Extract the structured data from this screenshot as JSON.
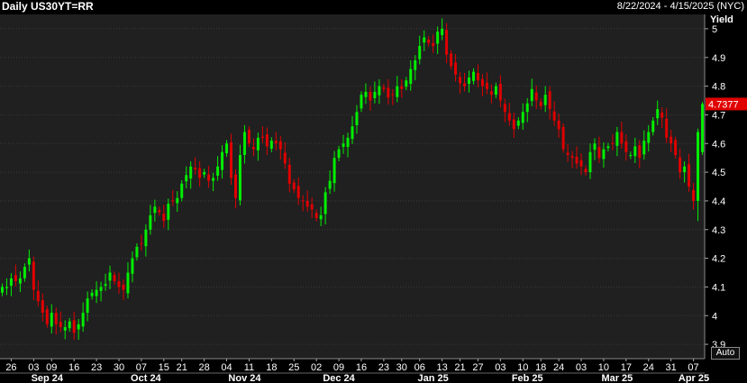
{
  "header": {
    "title": "Daily US30YT=RR",
    "date_range": "8/22/2024 - 4/15/2025 (NYC)"
  },
  "y_axis": {
    "label": "Yield",
    "auto_label": "Auto"
  },
  "colors": {
    "background": "#000000",
    "plot": "#202020",
    "grid": "#3a3a3a",
    "up": "#00ee00",
    "down": "#e00000",
    "badge": "#e00000",
    "text": "#ffffff"
  },
  "chart_data": {
    "type": "candlestick",
    "title": "Daily US30YT=RR",
    "ylabel": "Yield",
    "ylim": [
      3.85,
      5.05
    ],
    "yticks": [
      3.9,
      4,
      4.1,
      4.2,
      4.3,
      4.4,
      4.5,
      4.6,
      4.7,
      4.8,
      4.9,
      5
    ],
    "ytick_labels": [
      "3.9",
      "4",
      "4.1",
      "4.2",
      "4.3",
      "4.4",
      "4.5",
      "4.6",
      "4.7",
      "4.8",
      "4.9",
      "5"
    ],
    "last_value_label": "4.7377",
    "last_value": 4.7377,
    "grid": true,
    "day_ticks": [
      {
        "label": "26",
        "i": 2
      },
      {
        "label": "03",
        "i": 7
      },
      {
        "label": "09",
        "i": 11
      },
      {
        "label": "16",
        "i": 16
      },
      {
        "label": "23",
        "i": 21
      },
      {
        "label": "30",
        "i": 26
      },
      {
        "label": "07",
        "i": 31
      },
      {
        "label": "15",
        "i": 36
      },
      {
        "label": "21",
        "i": 40
      },
      {
        "label": "28",
        "i": 45
      },
      {
        "label": "04",
        "i": 50
      },
      {
        "label": "11",
        "i": 55
      },
      {
        "label": "18",
        "i": 60
      },
      {
        "label": "25",
        "i": 65
      },
      {
        "label": "02",
        "i": 70
      },
      {
        "label": "09",
        "i": 75
      },
      {
        "label": "16",
        "i": 80
      },
      {
        "label": "23",
        "i": 85
      },
      {
        "label": "30",
        "i": 89
      },
      {
        "label": "06",
        "i": 93
      },
      {
        "label": "13",
        "i": 98
      },
      {
        "label": "21",
        "i": 102
      },
      {
        "label": "27",
        "i": 106
      },
      {
        "label": "03",
        "i": 111
      },
      {
        "label": "10",
        "i": 116
      },
      {
        "label": "18",
        "i": 120
      },
      {
        "label": "24",
        "i": 124
      },
      {
        "label": "03",
        "i": 129
      },
      {
        "label": "10",
        "i": 134
      },
      {
        "label": "17",
        "i": 139
      },
      {
        "label": "24",
        "i": 144
      },
      {
        "label": "31",
        "i": 149
      },
      {
        "label": "07",
        "i": 154
      },
      {
        "label": "14",
        "i": 159
      }
    ],
    "month_ticks": [
      {
        "label": "Sep 24",
        "i": 10
      },
      {
        "label": "Oct 24",
        "i": 32
      },
      {
        "label": "Nov 24",
        "i": 54
      },
      {
        "label": "Dec 24",
        "i": 75
      },
      {
        "label": "Jan 25",
        "i": 96
      },
      {
        "label": "Feb 25",
        "i": 117
      },
      {
        "label": "Mar 25",
        "i": 137
      },
      {
        "label": "Apr 25",
        "i": 157
      }
    ],
    "closes": [
      4.1,
      4.1,
      4.13,
      4.12,
      4.13,
      4.17,
      4.2,
      4.09,
      4.05,
      4.01,
      3.97,
      4.01,
      3.97,
      3.96,
      3.96,
      3.98,
      3.94,
      3.97,
      4.01,
      4.06,
      4.08,
      4.09,
      4.1,
      4.11,
      4.15,
      4.12,
      4.1,
      4.09,
      4.15,
      4.2,
      4.24,
      4.25,
      4.3,
      4.35,
      4.38,
      4.36,
      4.33,
      4.39,
      4.4,
      4.41,
      4.46,
      4.49,
      4.52,
      4.51,
      4.48,
      4.5,
      4.47,
      4.48,
      4.52,
      4.57,
      4.6,
      4.48,
      4.41,
      4.56,
      4.64,
      4.6,
      4.58,
      4.62,
      4.62,
      4.59,
      4.61,
      4.6,
      4.58,
      4.53,
      4.46,
      4.44,
      4.41,
      4.4,
      4.38,
      4.37,
      4.34,
      4.35,
      4.43,
      4.47,
      4.55,
      4.58,
      4.6,
      4.62,
      4.66,
      4.71,
      4.77,
      4.78,
      4.75,
      4.78,
      4.8,
      4.79,
      4.76,
      4.77,
      4.8,
      4.79,
      4.82,
      4.86,
      4.89,
      4.94,
      4.97,
      4.95,
      4.94,
      4.99,
      5,
      4.91,
      4.87,
      4.84,
      4.81,
      4.8,
      4.83,
      4.85,
      4.82,
      4.8,
      4.79,
      4.77,
      4.8,
      4.75,
      4.71,
      4.68,
      4.65,
      4.68,
      4.71,
      4.74,
      4.79,
      4.75,
      4.73,
      4.77,
      4.72,
      4.68,
      4.65,
      4.58,
      4.56,
      4.55,
      4.53,
      4.52,
      4.5,
      4.57,
      4.6,
      4.55,
      4.58,
      4.59,
      4.6,
      4.64,
      4.6,
      4.57,
      4.56,
      4.59,
      4.55,
      4.61,
      4.64,
      4.68,
      4.72,
      4.69,
      4.62,
      4.6,
      4.56,
      4.5,
      4.52,
      4.45,
      4.4,
      4.64,
      4.7377
    ],
    "candles": []
  }
}
